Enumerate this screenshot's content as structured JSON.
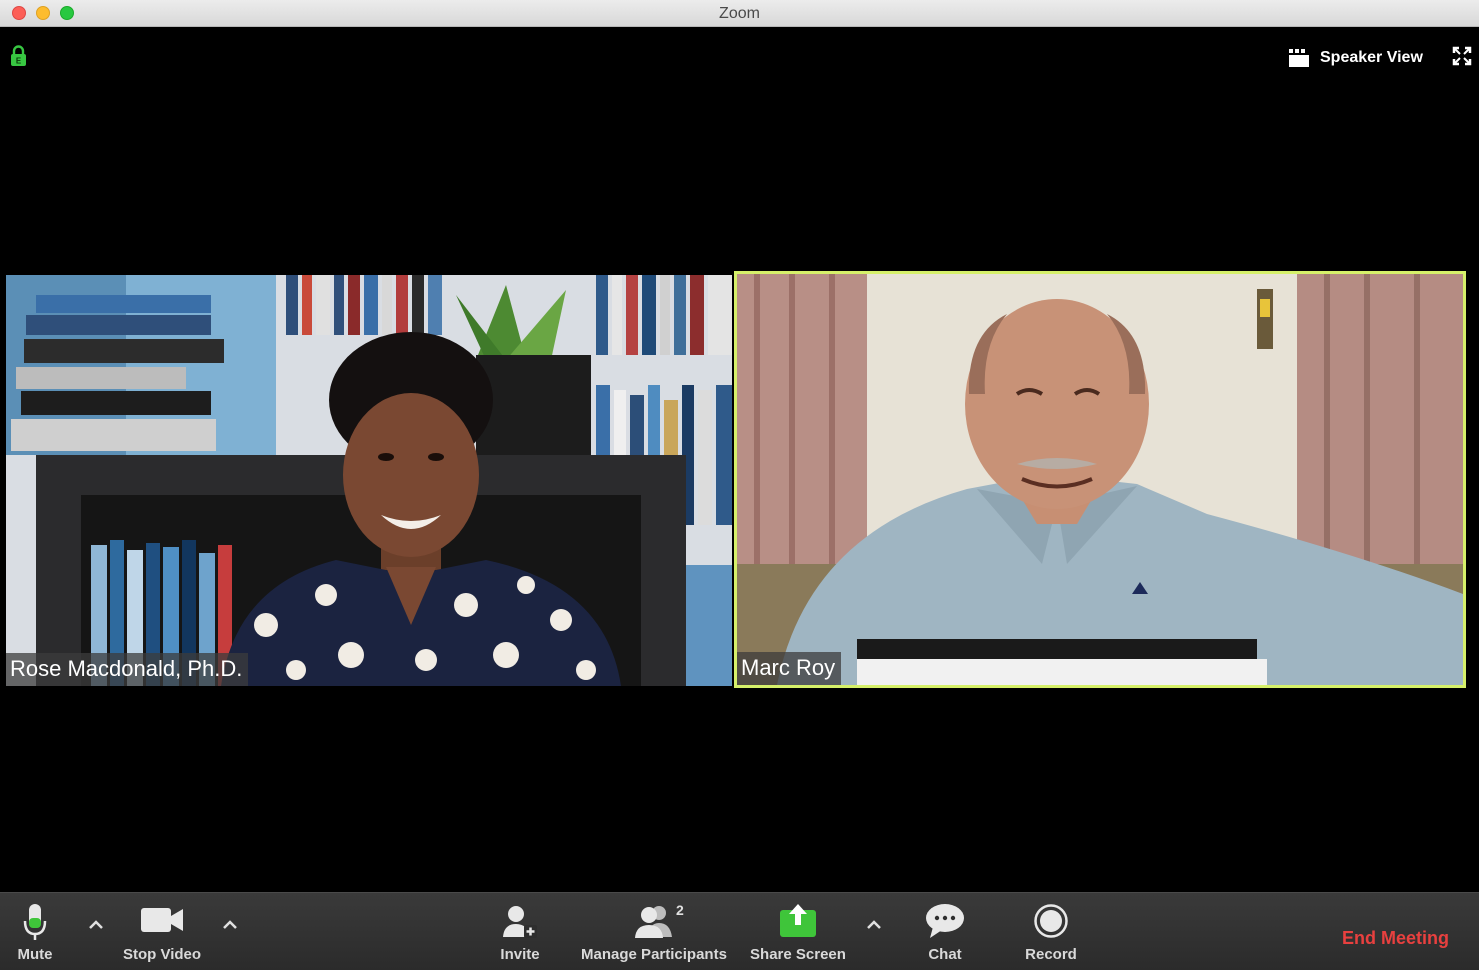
{
  "window": {
    "title": "Zoom"
  },
  "top_bar": {
    "view_mode_label": "Speaker View"
  },
  "participants": [
    {
      "name": "Rose Macdonald, Ph.D."
    },
    {
      "name": "Marc Roy"
    }
  ],
  "toolbar": {
    "mute_label": "Mute",
    "stop_video_label": "Stop Video",
    "invite_label": "Invite",
    "manage_participants_label": "Manage Participants",
    "participant_count": "2",
    "share_screen_label": "Share Screen",
    "chat_label": "Chat",
    "record_label": "Record",
    "end_meeting_label": "End Meeting"
  },
  "colors": {
    "active_speaker_border": "#d6f06a",
    "share_screen_green": "#3fc53a",
    "end_meeting_red": "#e8403f",
    "lock_green": "#38c742"
  }
}
